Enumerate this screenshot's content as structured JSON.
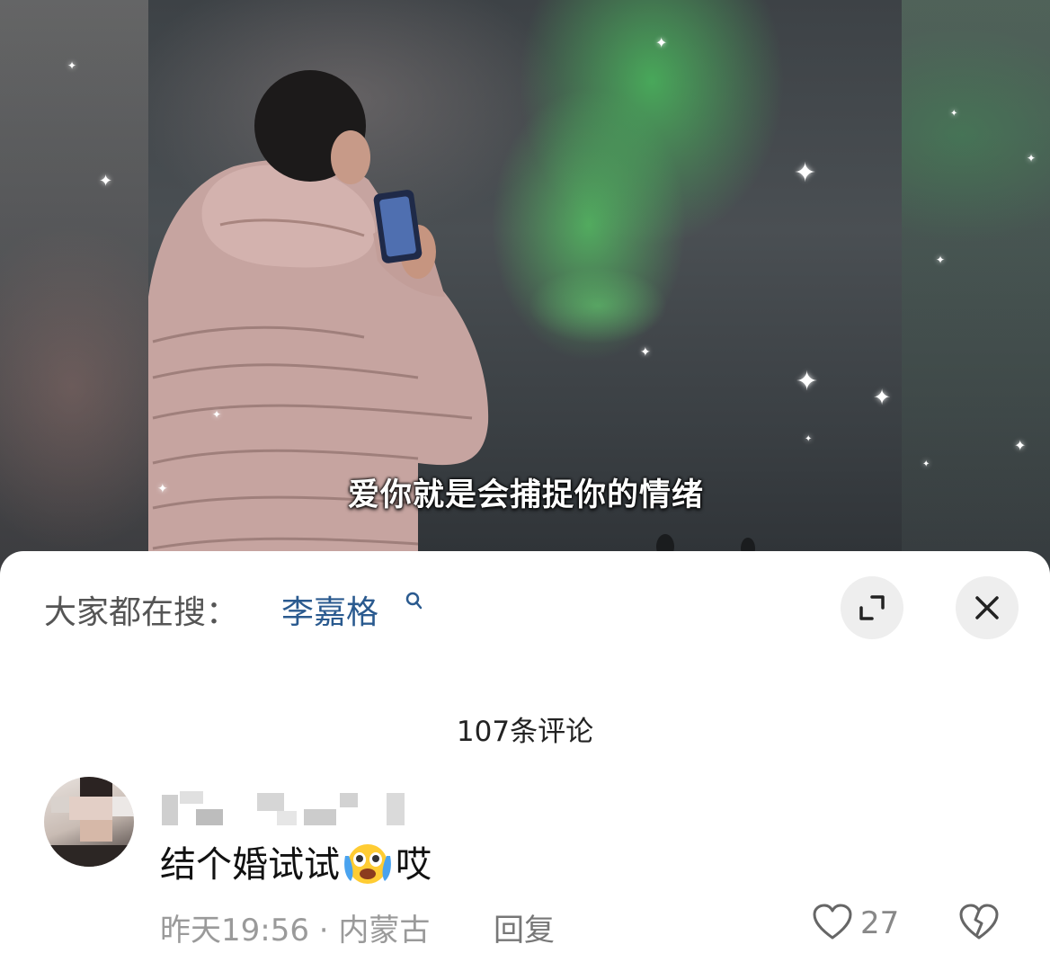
{
  "video": {
    "subtitle": "爱你就是会捕捉你的情绪"
  },
  "sheet": {
    "search_hint": "大家都在搜：",
    "search_term": "李嘉格",
    "comment_count": "107条评论"
  },
  "comment": {
    "text_before_emoji": "结个婚试试",
    "emoji": "crying-face",
    "text_after_emoji": "哎",
    "time": "昨天19:56",
    "separator": "·",
    "location": "内蒙古",
    "reply_label": "回复",
    "like_count": "27"
  },
  "colors": {
    "search_term": "#2a5a8f",
    "aurora_green": "#4fc864",
    "sheet_background": "#ffffff"
  }
}
